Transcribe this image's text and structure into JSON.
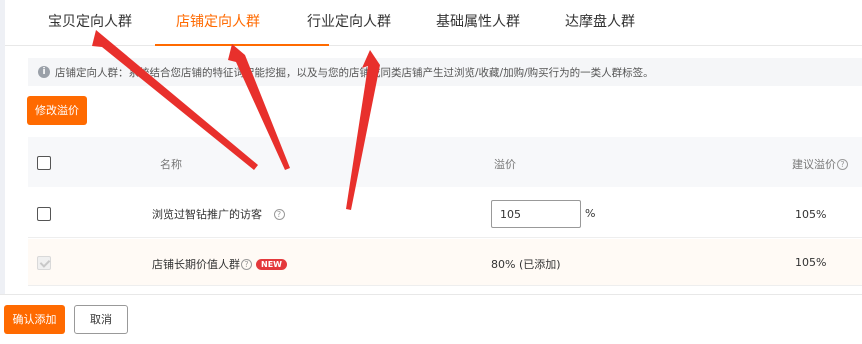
{
  "tabs": [
    {
      "label": "宝贝定向人群",
      "active": false
    },
    {
      "label": "店铺定向人群",
      "active": true
    },
    {
      "label": "行业定向人群",
      "active": false
    },
    {
      "label": "基础属性人群",
      "active": false
    },
    {
      "label": "达摩盘人群",
      "active": false
    }
  ],
  "info": {
    "icon": "info-icon",
    "text": "店铺定向人群：系统结合您店铺的特征词智能挖掘，以及与您的店铺或同类店铺产生过浏览/收藏/加购/购买行为的一类人群标签。"
  },
  "modify_button": "修改溢价",
  "table": {
    "columns": {
      "name": "名称",
      "premium": "溢价",
      "suggested": "建议溢价"
    },
    "rows": [
      {
        "name": "浏览过智钻推广的访客",
        "premium_input": "105",
        "premium_unit": "%",
        "suggested": "105%",
        "checked": false,
        "disabled": false
      },
      {
        "name": "店铺长期价值人群",
        "badge": "NEW",
        "premium_text": "80% (已添加)",
        "suggested": "105%",
        "checked": true,
        "disabled": true
      }
    ]
  },
  "footer": {
    "confirm": "确认添加",
    "cancel": "取消"
  },
  "colors": {
    "accent": "#ff6a00",
    "annotation_arrow": "#e8302c",
    "badge": "#e4393c"
  }
}
